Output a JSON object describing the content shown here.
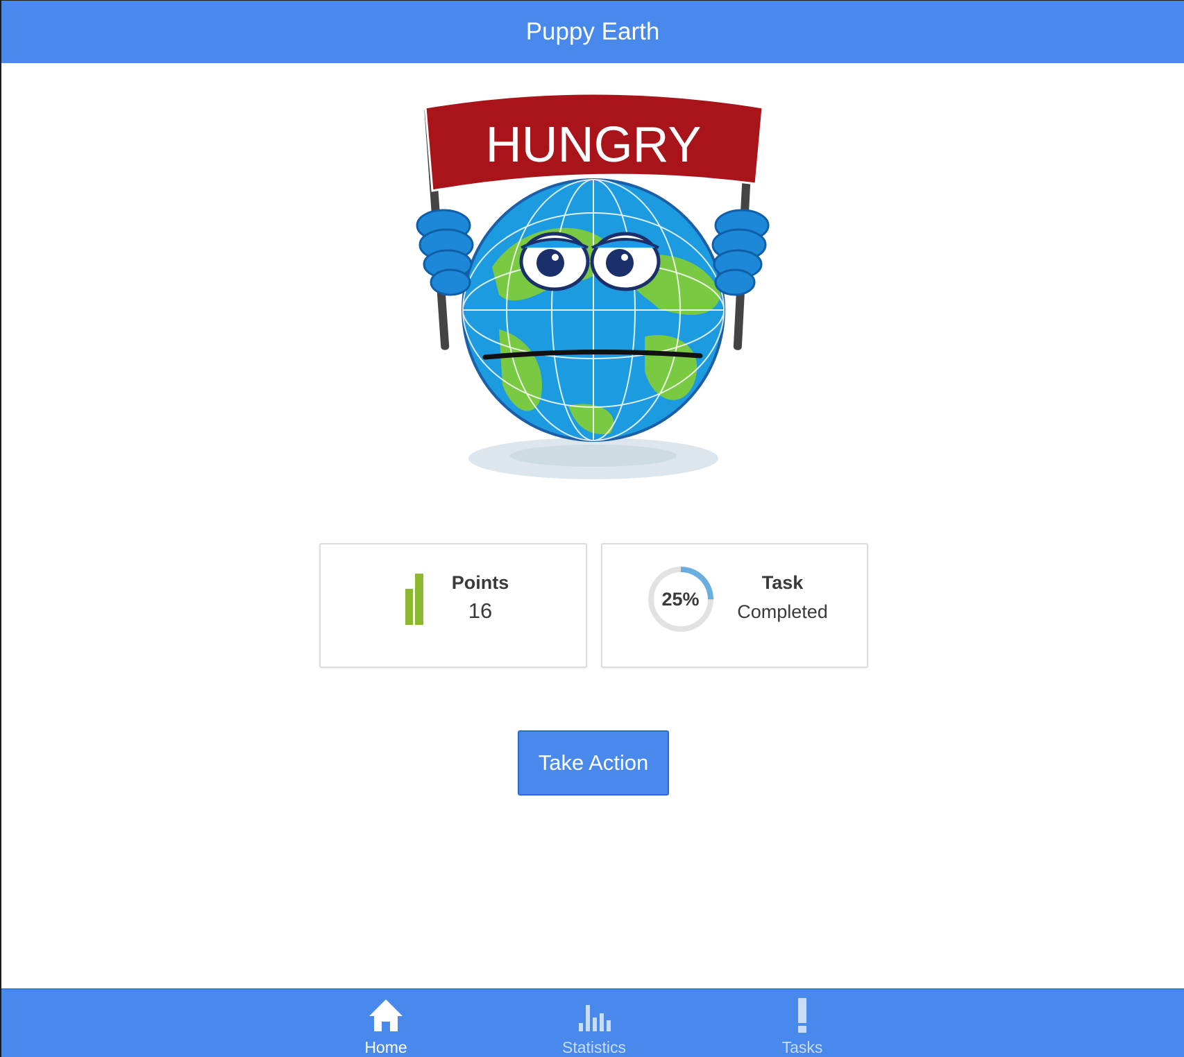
{
  "header": {
    "title": "Puppy Earth"
  },
  "mascot": {
    "banner_text": "HUNGRY",
    "icon": "hungry-earth-mascot"
  },
  "stats": {
    "points_label": "Points",
    "points_value": "16",
    "task_progress_text": "25%",
    "task_progress_fraction": 0.25,
    "task_label": "Task",
    "task_sub": "Completed"
  },
  "action": {
    "label": "Take Action"
  },
  "tabs": [
    {
      "label": "Home",
      "icon": "home-icon",
      "active": true
    },
    {
      "label": "Statistics",
      "icon": "bar-chart-icon",
      "active": false
    },
    {
      "label": "Tasks",
      "icon": "exclamation-icon",
      "active": false
    }
  ],
  "colors": {
    "primary": "#4a89ec",
    "points_bar": "#8cb92f",
    "progress_arc": "#6aaee0",
    "progress_track": "#e2e2e2",
    "banner_red": "#a8141a"
  }
}
